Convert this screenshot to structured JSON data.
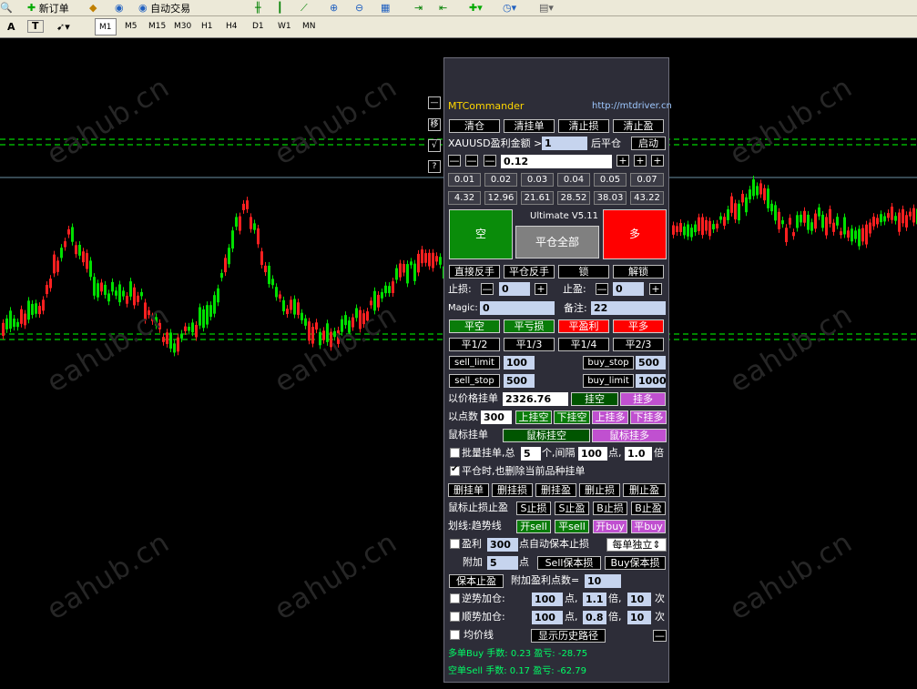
{
  "toolbar": {
    "new_order": "新订单",
    "auto_trading": "自动交易",
    "tools": [
      "A",
      "T"
    ],
    "timeframes": [
      "M1",
      "M5",
      "M15",
      "M30",
      "H1",
      "H4",
      "D1",
      "W1",
      "MN"
    ],
    "selected_timeframe": "M1"
  },
  "watermark": "eahub.cn",
  "panel": {
    "title": "MTCommander",
    "url": "http://mtdriver.cn",
    "side_buttons": [
      "—",
      "移",
      "√",
      "?"
    ],
    "row1": [
      "清仓",
      "清挂单",
      "清止损",
      "清止盈"
    ],
    "profit_label": "XAUUSD盈利金额 >",
    "profit_value": "1",
    "after_close": "后平仓",
    "start": "启动",
    "lot_minus": [
      "—",
      "—",
      "—"
    ],
    "lot_value": "0.12",
    "lot_plus": [
      "+",
      "+",
      "+"
    ],
    "lots_a": [
      "0.01",
      "0.02",
      "0.03",
      "0.04",
      "0.05",
      "0.07"
    ],
    "lots_b": [
      "4.32",
      "12.96",
      "21.61",
      "28.52",
      "38.03",
      "43.22"
    ],
    "sell_big": "空",
    "buy_big": "多",
    "version": "Ultimate V5.11",
    "close_all": "平仓全部",
    "row_reverse": [
      "直接反手",
      "平仓反手",
      "锁",
      "解锁"
    ],
    "sl_label": "止损:",
    "sl_value": "0",
    "tp_label": "止盈:",
    "tp_value": "0",
    "magic_label": "Magic:",
    "magic_value": "0",
    "note_label": "备注:",
    "note_value": "22",
    "close_row": [
      "平空",
      "平亏损",
      "平盈利",
      "平多"
    ],
    "partial_row": [
      "平1/2",
      "平1/3",
      "平1/4",
      "平2/3"
    ],
    "sell_limit": "sell_limit",
    "sell_limit_v": "100",
    "buy_stop": "buy_stop",
    "buy_stop_v": "500",
    "sell_stop": "sell_stop",
    "sell_stop_v": "500",
    "buy_limit": "buy_limit",
    "buy_limit_v": "1000",
    "price_pending": "以价格挂单",
    "price_value": "2326.76",
    "pend_sell": "挂空",
    "pend_buy": "挂多",
    "points_label": "以点数",
    "points_value": "300",
    "up_sell": "上挂空",
    "down_sell": "下挂空",
    "up_buy": "上挂多",
    "down_buy": "下挂多",
    "mouse_pending": "鼠标挂单",
    "mouse_sell": "鼠标挂空",
    "mouse_buy": "鼠标挂多",
    "batch": {
      "label": "批量挂单,总",
      "count": "5",
      "unit": "个,间隔",
      "interval": "100",
      "pt": "点,",
      "mult": "1.0",
      "times": "倍"
    },
    "delete_on_close": "平仓时,也删除当前品种挂单",
    "delete_row": [
      "删挂单",
      "删挂损",
      "删挂盈",
      "删止损",
      "删止盈"
    ],
    "mouse_sltp_label": "鼠标止损止盈",
    "mouse_sltp": [
      "S止损",
      "S止盈",
      "B止损",
      "B止盈"
    ],
    "trendline_label": "划线:趋势线",
    "trendline_btns": [
      "开sell",
      "平sell",
      "开buy",
      "平buy"
    ],
    "be_label": "盈利",
    "be_value": "300",
    "be_text": "点自动保本止损",
    "be_mode": "每单独立",
    "add_label": "附加",
    "add_value": "5",
    "add_pt": "点",
    "sell_be": "Sell保本损",
    "buy_be": "Buy保本损",
    "be_tp": "保本止盈",
    "add_profit_label": "附加盈利点数=",
    "add_profit_value": "10",
    "counter": {
      "label": "逆势加仓:",
      "pts": "100",
      "pt": "点,",
      "mult": "1.1",
      "x": "倍,",
      "times": "10",
      "t": "次"
    },
    "follow": {
      "label": "顺势加仓:",
      "pts": "100",
      "pt": "点,",
      "mult": "0.8",
      "x": "倍,",
      "times": "10",
      "t": "次"
    },
    "ma_label": "均价线",
    "history": "显示历史路径",
    "collapse": "—",
    "buy_summary": "多单Buy 手数: 0.23    盈亏: -28.75",
    "sell_summary": "空单Sell 手数: 0.17    盈亏: -62.79"
  },
  "colors": {
    "bull": "#00e000",
    "bear": "#ff2020",
    "level": "#00c000",
    "title": "#ffd700"
  }
}
